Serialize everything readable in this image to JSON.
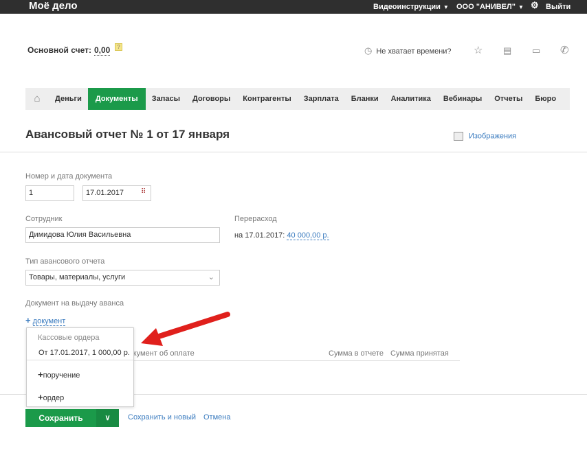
{
  "topbar": {
    "logo": "Моё дело",
    "videos": "Видеоинструкции",
    "company": "ООО \"АНИВЕЛ\"",
    "logout": "Выйти"
  },
  "header": {
    "account_label": "Основной счет:",
    "account_value": "0,00",
    "help": "?",
    "time_link": "Не хватает времени?"
  },
  "nav": {
    "items": [
      "Деньги",
      "Документы",
      "Запасы",
      "Договоры",
      "Контрагенты",
      "Зарплата",
      "Бланки",
      "Аналитика",
      "Вебинары",
      "Отчеты",
      "Бюро"
    ],
    "active": "Документы"
  },
  "page": {
    "title": "Авансовый отчет № 1 от 17 января",
    "images_link": "Изображения"
  },
  "form": {
    "number_date_label": "Номер и дата документа",
    "number": "1",
    "date": "17.01.2017",
    "employee_label": "Сотрудник",
    "employee": "Димидова Юлия Васильевна",
    "overspend_label": "Перерасход",
    "overspend_prefix": "на 17.01.2017:",
    "overspend_value": "40 000,00 р.",
    "type_label": "Тип авансового отчета",
    "type_value": "Товары, материалы, услуги",
    "advance_doc_label": "Документ на выдачу аванса",
    "add_document": "документ"
  },
  "table": {
    "col_doc": "Документ об оплате",
    "col_sum_report": "Сумма в отчете",
    "col_sum_accepted": "Сумма принятая"
  },
  "dropdown": {
    "group": "Кассовые ордера",
    "item": "От 17.01.2017, 1 000,00 р.",
    "add_order_pay": "поручение",
    "add_order": "ордер"
  },
  "footer": {
    "save": "Сохранить",
    "save_new": "Сохранить и новый",
    "cancel": "Отмена"
  }
}
